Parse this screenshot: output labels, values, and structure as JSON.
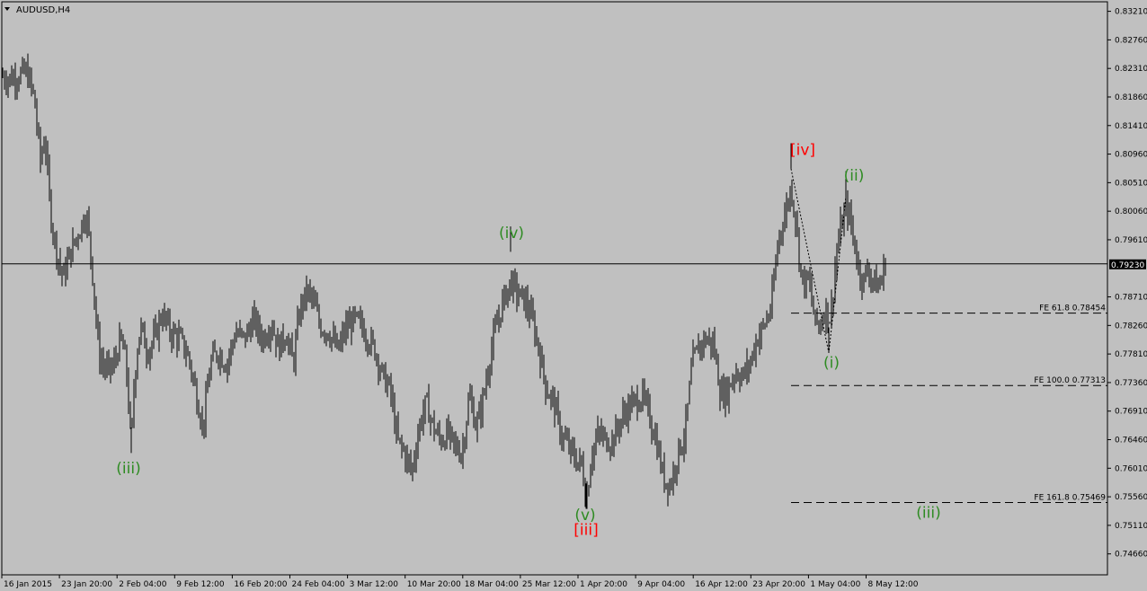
{
  "chart_data": {
    "type": "candlestick",
    "title": "AUDUSD,H4",
    "colors": {
      "background": "#c0c0c0",
      "bars": "#000000",
      "green_label": "#2e8b22",
      "red_label": "#ff0000"
    },
    "ylim": [
      0.7433,
      0.8336
    ],
    "y_ticks": [
      "0.83210",
      "0.82760",
      "0.82310",
      "0.81860",
      "0.81410",
      "0.80960",
      "0.80510",
      "0.80060",
      "0.79610",
      "0.79160",
      "0.78710",
      "0.78260",
      "0.77810",
      "0.77360",
      "0.76910",
      "0.76460",
      "0.76010",
      "0.75560",
      "0.75110",
      "0.74660"
    ],
    "x_ticks": [
      "16 Jan 2015",
      "23 Jan 20:00",
      "2 Feb 04:00",
      "9 Feb 12:00",
      "16 Feb 20:00",
      "24 Feb 04:00",
      "3 Mar 12:00",
      "10 Mar 20:00",
      "18 Mar 04:00",
      "25 Mar 12:00",
      "1 Apr 20:00",
      "9 Apr 04:00",
      "16 Apr 12:00",
      "23 Apr 20:00",
      "1 May 04:00",
      "8 May 12:00"
    ],
    "current_price": "0.79230",
    "price_path": [
      [
        0,
        0.822
      ],
      [
        10,
        0.8215
      ],
      [
        20,
        0.822
      ],
      [
        30,
        0.8225
      ],
      [
        38,
        0.8185
      ],
      [
        45,
        0.8085
      ],
      [
        50,
        0.8125
      ],
      [
        56,
        0.8005
      ],
      [
        62,
        0.795
      ],
      [
        70,
        0.79
      ],
      [
        78,
        0.794
      ],
      [
        88,
        0.7975
      ],
      [
        96,
        0.8005
      ],
      [
        102,
        0.7925
      ],
      [
        110,
        0.778
      ],
      [
        118,
        0.7755
      ],
      [
        126,
        0.776
      ],
      [
        134,
        0.7805
      ],
      [
        140,
        0.777
      ],
      [
        146,
        0.7635
      ],
      [
        150,
        0.7755
      ],
      [
        156,
        0.7825
      ],
      [
        164,
        0.7785
      ],
      [
        172,
        0.7805
      ],
      [
        180,
        0.7845
      ],
      [
        190,
        0.7815
      ],
      [
        200,
        0.7805
      ],
      [
        210,
        0.7775
      ],
      [
        218,
        0.772
      ],
      [
        226,
        0.7665
      ],
      [
        234,
        0.7765
      ],
      [
        242,
        0.7785
      ],
      [
        252,
        0.7765
      ],
      [
        262,
        0.7815
      ],
      [
        272,
        0.7805
      ],
      [
        282,
        0.7835
      ],
      [
        292,
        0.7805
      ],
      [
        302,
        0.783
      ],
      [
        310,
        0.779
      ],
      [
        318,
        0.7815
      ],
      [
        326,
        0.7765
      ],
      [
        334,
        0.7855
      ],
      [
        342,
        0.788
      ],
      [
        348,
        0.7865
      ],
      [
        356,
        0.7825
      ],
      [
        366,
        0.7815
      ],
      [
        376,
        0.7785
      ],
      [
        384,
        0.782
      ],
      [
        394,
        0.7835
      ],
      [
        402,
        0.7825
      ],
      [
        410,
        0.7805
      ],
      [
        418,
        0.7785
      ],
      [
        426,
        0.7745
      ],
      [
        434,
        0.7725
      ],
      [
        442,
        0.7645
      ],
      [
        450,
        0.7625
      ],
      [
        458,
        0.7595
      ],
      [
        466,
        0.7665
      ],
      [
        474,
        0.7705
      ],
      [
        482,
        0.7665
      ],
      [
        490,
        0.7645
      ],
      [
        498,
        0.7655
      ],
      [
        506,
        0.7635
      ],
      [
        514,
        0.7625
      ],
      [
        522,
        0.7715
      ],
      [
        530,
        0.7665
      ],
      [
        538,
        0.7715
      ],
      [
        546,
        0.7785
      ],
      [
        554,
        0.7835
      ],
      [
        560,
        0.7865
      ],
      [
        568,
        0.7895
      ],
      [
        576,
        0.7875
      ],
      [
        584,
        0.7865
      ],
      [
        592,
        0.7835
      ],
      [
        600,
        0.7785
      ],
      [
        608,
        0.7725
      ],
      [
        616,
        0.7705
      ],
      [
        624,
        0.7655
      ],
      [
        632,
        0.7635
      ],
      [
        640,
        0.7615
      ],
      [
        648,
        0.7605
      ],
      [
        652,
        0.7545
      ],
      [
        658,
        0.7625
      ],
      [
        666,
        0.7655
      ],
      [
        674,
        0.7645
      ],
      [
        682,
        0.7645
      ],
      [
        690,
        0.7675
      ],
      [
        698,
        0.7695
      ],
      [
        706,
        0.7705
      ],
      [
        714,
        0.7715
      ],
      [
        722,
        0.7685
      ],
      [
        730,
        0.7645
      ],
      [
        738,
        0.7585
      ],
      [
        746,
        0.7575
      ],
      [
        754,
        0.7625
      ],
      [
        762,
        0.7655
      ],
      [
        770,
        0.7765
      ],
      [
        778,
        0.7795
      ],
      [
        786,
        0.7805
      ],
      [
        794,
        0.7795
      ],
      [
        802,
        0.7715
      ],
      [
        810,
        0.7725
      ],
      [
        818,
        0.7755
      ],
      [
        826,
        0.7745
      ],
      [
        834,
        0.7765
      ],
      [
        842,
        0.7805
      ],
      [
        850,
        0.7825
      ],
      [
        858,
        0.7855
      ],
      [
        866,
        0.7965
      ],
      [
        874,
        0.8005
      ],
      [
        880,
        0.8045
      ],
      [
        886,
        0.7985
      ],
      [
        892,
        0.7895
      ],
      [
        900,
        0.7895
      ],
      [
        906,
        0.7835
      ],
      [
        912,
        0.7825
      ],
      [
        918,
        0.7855
      ],
      [
        924,
        0.7835
      ],
      [
        930,
        0.7935
      ],
      [
        936,
        0.7985
      ],
      [
        942,
        0.8015
      ],
      [
        948,
        0.7975
      ],
      [
        954,
        0.7925
      ],
      [
        960,
        0.7895
      ],
      [
        966,
        0.7915
      ],
      [
        972,
        0.7895
      ],
      [
        978,
        0.7885
      ],
      [
        985,
        0.7925
      ]
    ]
  },
  "fe_levels": [
    {
      "name": "FE 61.8",
      "value": "0.78454",
      "num": 0.78454
    },
    {
      "name": "FE 100.0",
      "value": "0.77313",
      "num": 0.77313
    },
    {
      "name": "FE 161.8",
      "value": "0.75469",
      "num": 0.75469
    }
  ],
  "wave_labels": [
    {
      "text": "(iii)",
      "price": 0.7593,
      "bar": 143,
      "color": "green"
    },
    {
      "text": "(iv)",
      "price": 0.7964,
      "bar": 569,
      "color": "green"
    },
    {
      "text": "(v)",
      "price": 0.7519,
      "bar": 651,
      "color": "green"
    },
    {
      "text": "[iii]",
      "price": 0.7496,
      "bar": 652,
      "color": "red"
    },
    {
      "text": "[iv]",
      "price": 0.8095,
      "bar": 893,
      "color": "red"
    },
    {
      "text": "(ii)",
      "price": 0.8054,
      "bar": 950,
      "color": "green"
    },
    {
      "text": "(i)",
      "price": 0.7759,
      "bar": 925,
      "color": "green"
    },
    {
      "text": "(iii)",
      "price": 0.7523,
      "bar": 1033,
      "color": "green"
    }
  ]
}
